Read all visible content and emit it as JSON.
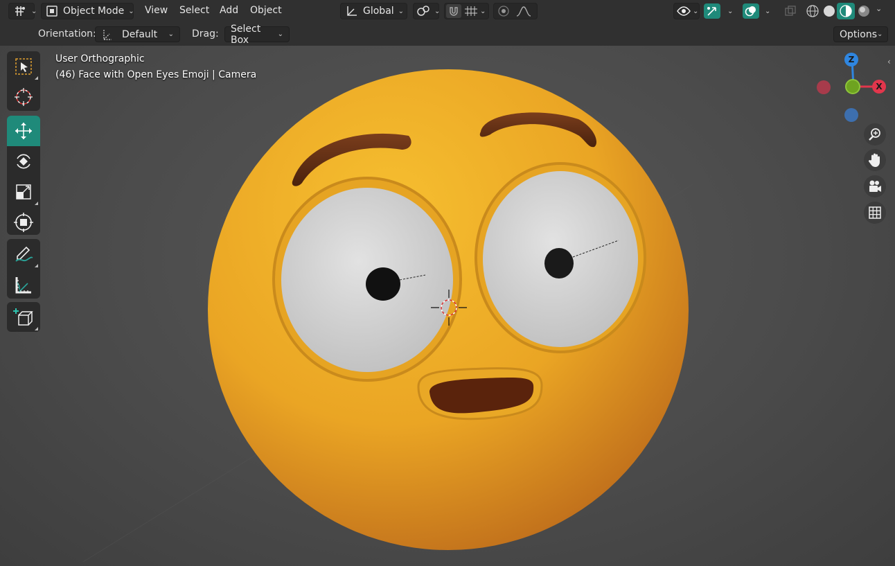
{
  "header": {
    "editor_type_icon": "viewport-editor-icon",
    "mode": {
      "label": "Object Mode",
      "icon": "object-mode-icon"
    },
    "menus": [
      "View",
      "Select",
      "Add",
      "Object"
    ],
    "transform_orientation": {
      "label": "Global",
      "icon": "orientation-axes-icon"
    },
    "pivot_icon": "pivot-point-icon",
    "snap_icon": "magnet-snap-icon",
    "snap_increment_icon": "snap-increment-icon",
    "proportional_icon": "proportional-editing-icon",
    "falloff_icon": "falloff-curve-icon",
    "visibility_icon": "eye-icon",
    "gizmo_icon": "gizmo-icon",
    "overlay_icon": "overlay-icon",
    "xray_icon": "xray-icon",
    "shading_modes": [
      "wireframe",
      "solid",
      "material-preview",
      "rendered"
    ],
    "active_shading": "material-preview"
  },
  "tool_settings": {
    "orientation_label": "Orientation:",
    "orientation_value": "Default",
    "drag_label": "Drag:",
    "drag_value": "Select Box",
    "options_label": "Options"
  },
  "toolbar": {
    "groups": [
      [
        "select-box",
        "cursor"
      ],
      [
        "move",
        "rotate",
        "scale",
        "transform"
      ],
      [
        "annotate",
        "measure"
      ],
      [
        "add-cube"
      ]
    ],
    "active_tool": "move"
  },
  "viewport": {
    "view_name": "User Orthographic",
    "object_info": "(46) Face with Open Eyes Emoji | Camera"
  },
  "nav_gizmo": {
    "axis_z": "Z",
    "axis_x": "X",
    "colors": {
      "x": "#e2364c",
      "y": "#6ea320",
      "z": "#2f86e0"
    }
  },
  "nav_buttons": [
    "zoom-icon",
    "hand-pan-icon",
    "camera-icon",
    "grid-icon"
  ],
  "colors": {
    "accent": "#1f8a7a",
    "header_bg": "#303030",
    "emoji_yellow": "#f0b028",
    "brow_brown": "#5a2c12"
  }
}
